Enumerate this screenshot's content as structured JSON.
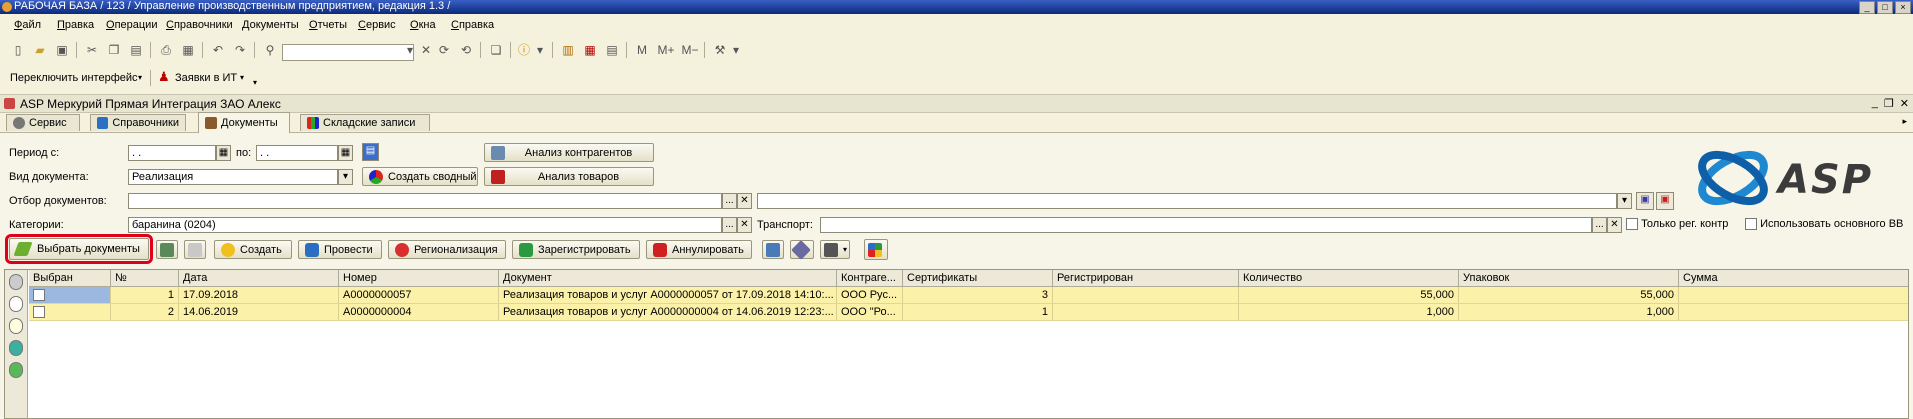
{
  "window": {
    "title": "РАБОЧАЯ БАЗА / 123 /  Управление производственным предприятием, редакция 1.3 /"
  },
  "menu": [
    "Файл",
    "Правка",
    "Операции",
    "Справочники",
    "Документы",
    "Отчеты",
    "Сервис",
    "Окна",
    "Справка"
  ],
  "toolbar2": {
    "switch_interface": "Переключить интерфейс",
    "requests": "Заявки в ИТ"
  },
  "form": {
    "title": "ASP Меркурий Прямая Интеграция ЗАО Алекс"
  },
  "tabs": [
    {
      "label": "Сервис",
      "icon": "gear-icon"
    },
    {
      "label": "Справочники",
      "icon": "book-icon"
    },
    {
      "label": "Документы",
      "icon": "briefcase-icon"
    },
    {
      "label": "Складские записи",
      "icon": "blocks-icon"
    }
  ],
  "filters": {
    "period_from_label": "Период с:",
    "period_from_value": " .  .",
    "period_to_label": "по:",
    "period_to_value": " .  .",
    "doc_type_label": "Вид документа:",
    "doc_type_value": "Реализация",
    "doc_filter_label": "Отбор документов:",
    "doc_filter_value": "",
    "category_label": "Категории:",
    "category_value": "баранина (0204)",
    "transport_label": "Транспорт:",
    "transport_value": "",
    "only_reg_label": "Только рег. контр",
    "use_main_label": "Использовать основного ВВ"
  },
  "buttons": {
    "contractor_analysis": "Анализ контрагентов",
    "create_summary": "Создать сводный",
    "goods_analysis": "Анализ товаров",
    "select_documents": "Выбрать документы",
    "create": "Создать",
    "post": "Провести",
    "regionalization": "Регионализация",
    "register": "Зарегистрировать",
    "annul": "Аннулировать"
  },
  "logo_text": "ASP",
  "grid": {
    "columns": [
      "Выбран",
      "№",
      "Дата",
      "Номер",
      "Документ",
      "Контраге...",
      "Сертификаты",
      "Регистрирован",
      "Количество",
      "Упаковок",
      "Сумма"
    ],
    "rows": [
      {
        "selected": "",
        "n": "1",
        "date": "17.09.2018",
        "number": "А0000000057",
        "document": "Реализация товаров и услуг А0000000057 от 17.09.2018 14:10:...",
        "contractor": "ООО Рус...",
        "certificates": "3",
        "registered": "",
        "quantity": "55,000",
        "packages": "55,000",
        "sum": ""
      },
      {
        "selected": "",
        "n": "2",
        "date": "14.06.2019",
        "number": "А0000000004",
        "document": "Реализация товаров и услуг А0000000004 от 14.06.2019 12:23:...",
        "contractor": "ООО \"Ро...",
        "certificates": "1",
        "registered": "",
        "quantity": "1,000",
        "packages": "1,000",
        "sum": ""
      }
    ]
  },
  "colors": {
    "title_bar": "#0a2a7a",
    "row_highlight": "#fbf1a9",
    "select_docs_outline": "#e0001a",
    "logo_blue": "#1e88d0"
  }
}
